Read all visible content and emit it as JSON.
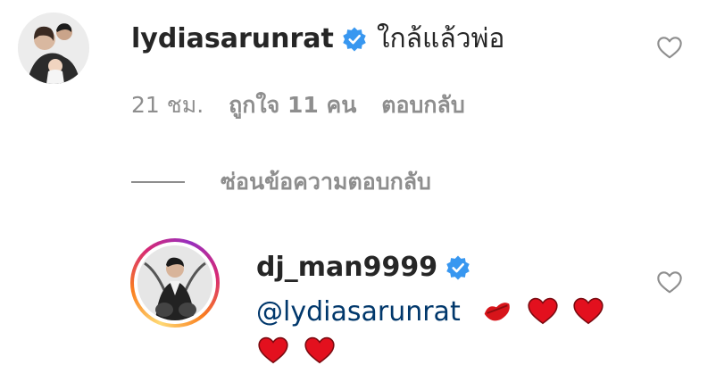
{
  "comment": {
    "username": "lydiasarunrat",
    "text": "ใกล้แล้วพ่อ",
    "time": "21 ชม.",
    "likes": "ถูกใจ 11 คน",
    "reply_label": "ตอบกลับ",
    "hide_replies_label": "ซ่อนข้อความตอบกลับ"
  },
  "reply": {
    "username": "dj_man9999",
    "mention": "@lydiasarunrat",
    "emojis": [
      "kiss-mark",
      "red-heart",
      "red-heart",
      "red-heart",
      "red-heart"
    ]
  },
  "colors": {
    "verified": "#3897f0",
    "mention": "#00376b",
    "meta": "#8e8e8e",
    "heart": "#e0245e"
  }
}
